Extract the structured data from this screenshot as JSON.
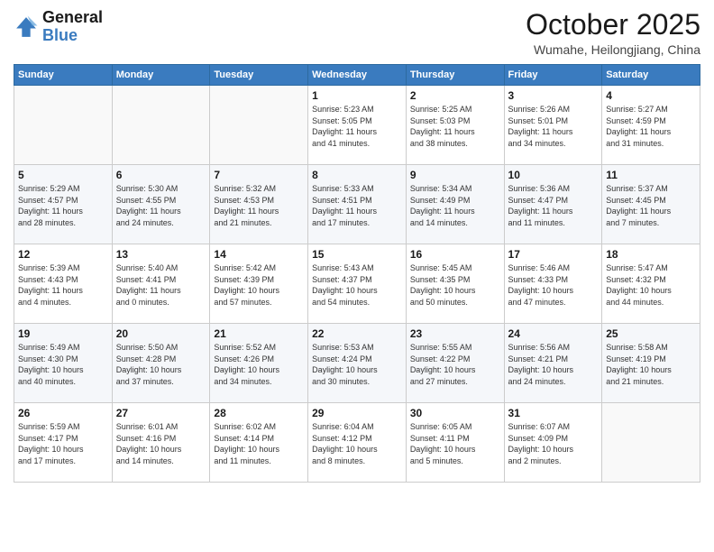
{
  "header": {
    "logo_general": "General",
    "logo_blue": "Blue",
    "month": "October 2025",
    "location": "Wumahe, Heilongjiang, China"
  },
  "days_of_week": [
    "Sunday",
    "Monday",
    "Tuesday",
    "Wednesday",
    "Thursday",
    "Friday",
    "Saturday"
  ],
  "weeks": [
    [
      {
        "day": "",
        "info": ""
      },
      {
        "day": "",
        "info": ""
      },
      {
        "day": "",
        "info": ""
      },
      {
        "day": "1",
        "info": "Sunrise: 5:23 AM\nSunset: 5:05 PM\nDaylight: 11 hours\nand 41 minutes."
      },
      {
        "day": "2",
        "info": "Sunrise: 5:25 AM\nSunset: 5:03 PM\nDaylight: 11 hours\nand 38 minutes."
      },
      {
        "day": "3",
        "info": "Sunrise: 5:26 AM\nSunset: 5:01 PM\nDaylight: 11 hours\nand 34 minutes."
      },
      {
        "day": "4",
        "info": "Sunrise: 5:27 AM\nSunset: 4:59 PM\nDaylight: 11 hours\nand 31 minutes."
      }
    ],
    [
      {
        "day": "5",
        "info": "Sunrise: 5:29 AM\nSunset: 4:57 PM\nDaylight: 11 hours\nand 28 minutes."
      },
      {
        "day": "6",
        "info": "Sunrise: 5:30 AM\nSunset: 4:55 PM\nDaylight: 11 hours\nand 24 minutes."
      },
      {
        "day": "7",
        "info": "Sunrise: 5:32 AM\nSunset: 4:53 PM\nDaylight: 11 hours\nand 21 minutes."
      },
      {
        "day": "8",
        "info": "Sunrise: 5:33 AM\nSunset: 4:51 PM\nDaylight: 11 hours\nand 17 minutes."
      },
      {
        "day": "9",
        "info": "Sunrise: 5:34 AM\nSunset: 4:49 PM\nDaylight: 11 hours\nand 14 minutes."
      },
      {
        "day": "10",
        "info": "Sunrise: 5:36 AM\nSunset: 4:47 PM\nDaylight: 11 hours\nand 11 minutes."
      },
      {
        "day": "11",
        "info": "Sunrise: 5:37 AM\nSunset: 4:45 PM\nDaylight: 11 hours\nand 7 minutes."
      }
    ],
    [
      {
        "day": "12",
        "info": "Sunrise: 5:39 AM\nSunset: 4:43 PM\nDaylight: 11 hours\nand 4 minutes."
      },
      {
        "day": "13",
        "info": "Sunrise: 5:40 AM\nSunset: 4:41 PM\nDaylight: 11 hours\nand 0 minutes."
      },
      {
        "day": "14",
        "info": "Sunrise: 5:42 AM\nSunset: 4:39 PM\nDaylight: 10 hours\nand 57 minutes."
      },
      {
        "day": "15",
        "info": "Sunrise: 5:43 AM\nSunset: 4:37 PM\nDaylight: 10 hours\nand 54 minutes."
      },
      {
        "day": "16",
        "info": "Sunrise: 5:45 AM\nSunset: 4:35 PM\nDaylight: 10 hours\nand 50 minutes."
      },
      {
        "day": "17",
        "info": "Sunrise: 5:46 AM\nSunset: 4:33 PM\nDaylight: 10 hours\nand 47 minutes."
      },
      {
        "day": "18",
        "info": "Sunrise: 5:47 AM\nSunset: 4:32 PM\nDaylight: 10 hours\nand 44 minutes."
      }
    ],
    [
      {
        "day": "19",
        "info": "Sunrise: 5:49 AM\nSunset: 4:30 PM\nDaylight: 10 hours\nand 40 minutes."
      },
      {
        "day": "20",
        "info": "Sunrise: 5:50 AM\nSunset: 4:28 PM\nDaylight: 10 hours\nand 37 minutes."
      },
      {
        "day": "21",
        "info": "Sunrise: 5:52 AM\nSunset: 4:26 PM\nDaylight: 10 hours\nand 34 minutes."
      },
      {
        "day": "22",
        "info": "Sunrise: 5:53 AM\nSunset: 4:24 PM\nDaylight: 10 hours\nand 30 minutes."
      },
      {
        "day": "23",
        "info": "Sunrise: 5:55 AM\nSunset: 4:22 PM\nDaylight: 10 hours\nand 27 minutes."
      },
      {
        "day": "24",
        "info": "Sunrise: 5:56 AM\nSunset: 4:21 PM\nDaylight: 10 hours\nand 24 minutes."
      },
      {
        "day": "25",
        "info": "Sunrise: 5:58 AM\nSunset: 4:19 PM\nDaylight: 10 hours\nand 21 minutes."
      }
    ],
    [
      {
        "day": "26",
        "info": "Sunrise: 5:59 AM\nSunset: 4:17 PM\nDaylight: 10 hours\nand 17 minutes."
      },
      {
        "day": "27",
        "info": "Sunrise: 6:01 AM\nSunset: 4:16 PM\nDaylight: 10 hours\nand 14 minutes."
      },
      {
        "day": "28",
        "info": "Sunrise: 6:02 AM\nSunset: 4:14 PM\nDaylight: 10 hours\nand 11 minutes."
      },
      {
        "day": "29",
        "info": "Sunrise: 6:04 AM\nSunset: 4:12 PM\nDaylight: 10 hours\nand 8 minutes."
      },
      {
        "day": "30",
        "info": "Sunrise: 6:05 AM\nSunset: 4:11 PM\nDaylight: 10 hours\nand 5 minutes."
      },
      {
        "day": "31",
        "info": "Sunrise: 6:07 AM\nSunset: 4:09 PM\nDaylight: 10 hours\nand 2 minutes."
      },
      {
        "day": "",
        "info": ""
      }
    ]
  ]
}
